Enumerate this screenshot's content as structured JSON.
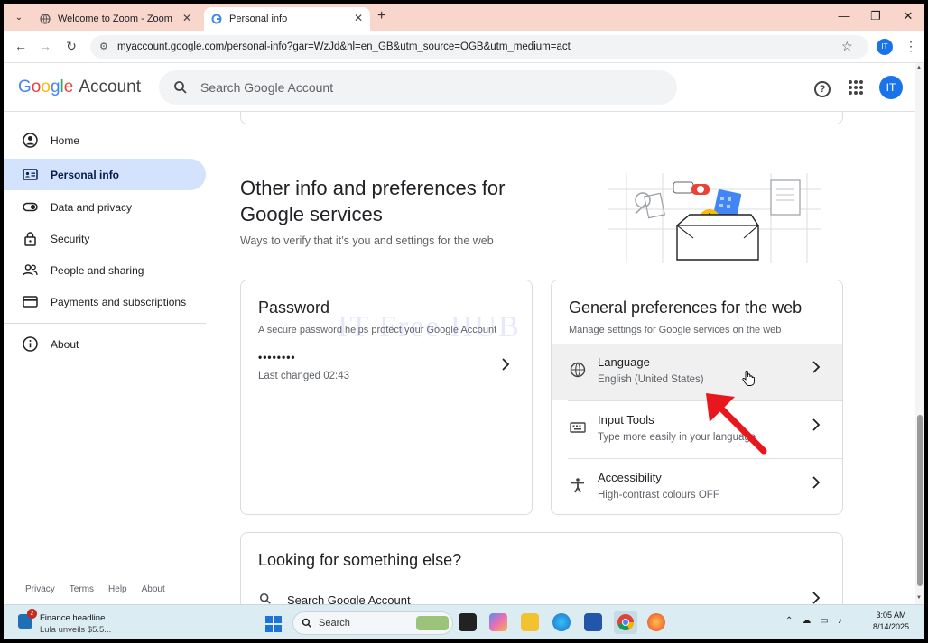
{
  "browser": {
    "tabs": [
      {
        "label": "Welcome to Zoom - Zoom"
      },
      {
        "label": "Personal info"
      }
    ],
    "url": "myaccount.google.com/personal-info?gar=WzJd&hl=en_GB&utm_source=OGB&utm_medium=act",
    "profile_initials": "IT"
  },
  "header": {
    "logo_google": "Google",
    "logo_account": "Account",
    "search_placeholder": "Search Google Account",
    "avatar_initials": "IT"
  },
  "sidebar": {
    "items": [
      {
        "label": "Home",
        "icon": "person-circle-icon"
      },
      {
        "label": "Personal info",
        "icon": "id-card-icon",
        "active": true
      },
      {
        "label": "Data and privacy",
        "icon": "toggle-icon"
      },
      {
        "label": "Security",
        "icon": "lock-icon"
      },
      {
        "label": "People and sharing",
        "icon": "people-icon"
      },
      {
        "label": "Payments and subscriptions",
        "icon": "credit-card-icon"
      },
      {
        "label": "About",
        "icon": "info-icon"
      }
    ],
    "footer": [
      "Privacy",
      "Terms",
      "Help",
      "About"
    ]
  },
  "main": {
    "section_title": "Other info and preferences for Google services",
    "section_subtitle": "Ways to verify that it’s you and settings for the web",
    "password_card": {
      "title": "Password",
      "subtitle": "A secure password helps protect your Google Account",
      "masked": "••••••••",
      "last_changed": "Last changed 02:43"
    },
    "general_prefs_card": {
      "title": "General preferences for the web",
      "subtitle": "Manage settings for Google services on the web",
      "rows": [
        {
          "title": "Language",
          "value": "English (United States)",
          "icon": "globe-icon"
        },
        {
          "title": "Input Tools",
          "value": "Type more easily in your language",
          "icon": "keyboard-icon"
        },
        {
          "title": "Accessibility",
          "value": "High-contrast colours OFF",
          "icon": "accessibility-icon"
        }
      ]
    },
    "looking_card": {
      "title": "Looking for something else?",
      "search_label": "Search Google Account"
    },
    "watermark": "IT Free HUB"
  },
  "taskbar": {
    "news_badge": "2",
    "news_title": "Finance headline",
    "news_sub": "Lula unveils $5.5...",
    "search_label": "Search",
    "time": "3:05 AM",
    "date": "8/14/2025"
  },
  "colors": {
    "accent": "#1a73e8",
    "active_nav_bg": "#d3e3fd",
    "tab_strip": "#f9d6cb",
    "annotation_arrow": "#e8161d"
  }
}
